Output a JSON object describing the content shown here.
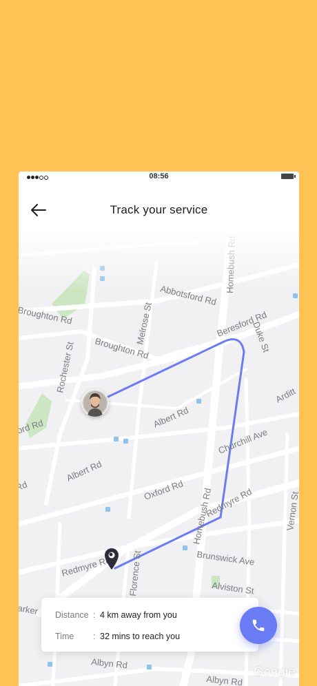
{
  "status_bar": {
    "time": "08:56",
    "signal_dots_filled": 3,
    "signal_dots_total": 5
  },
  "header": {
    "back_icon": "arrow-left-icon",
    "title": "Track your service"
  },
  "map": {
    "streets": [
      "Abbotsford Rd",
      "Homebush Rd",
      "Broughton Rd",
      "Melrose St",
      "Beresford Rd",
      "Duke St",
      "Rochester St",
      "Broughton Rd",
      "Arditt",
      "ford Rd",
      "Albert Rd",
      "Churchill Ave",
      "Albert Rd",
      "Rd",
      "Oxford Rd",
      "Homebush Rd",
      "Redmyre Rd",
      "Vernon St",
      "Redmyre Rd",
      "Brunswick Ave",
      "Florence St",
      "Alviston St",
      "arker",
      "Albyn Rd",
      "Albyn Rd"
    ],
    "attribution": "Google",
    "route_color": "#6A7CF3"
  },
  "tracking": {
    "avatar_icon": "technician-avatar",
    "destination_icon": "location-pin-icon"
  },
  "info_card": {
    "distance_label": "Distance",
    "distance_value": "4 km away from you",
    "time_label": "Time",
    "time_value": "32 mins to reach you",
    "separator": ":"
  },
  "call_button": {
    "icon": "phone-icon",
    "color": "#6A7CF3"
  },
  "colors": {
    "background": "#FFC254",
    "map_land": "#F1F1F3",
    "map_road": "#FFFFFF",
    "park": "#CDE6C2",
    "text_dark": "#1b1b1f"
  }
}
